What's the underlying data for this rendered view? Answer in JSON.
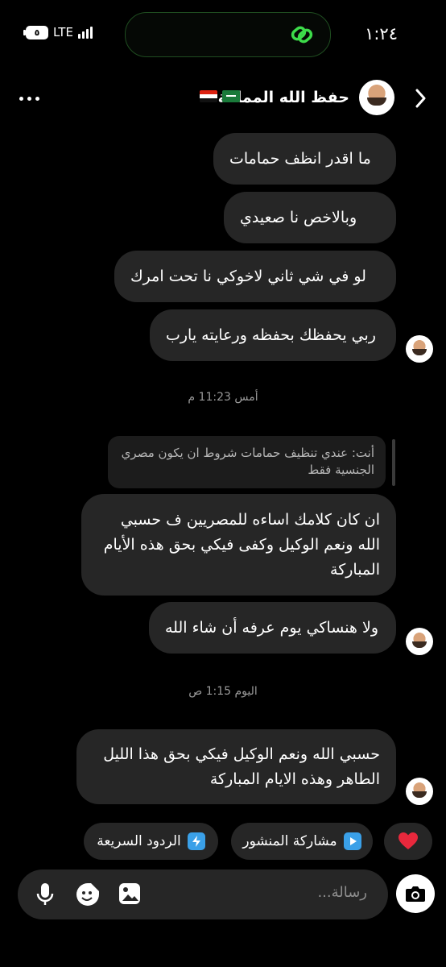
{
  "status_bar": {
    "time": "١:٢٤",
    "network": "LTE",
    "battery": "٥"
  },
  "header": {
    "name": "حفظ الله المملكة",
    "flags": [
      "saudi-flag",
      "egypt-flag"
    ]
  },
  "messages_group1": [
    "ما اقدر انظف حمامات",
    "وبالاخص نا صعيدي",
    "لو في شي ثاني لاخوكي نا تحت امرك",
    "ربي يحفظك بحفظه ورعايته يارب"
  ],
  "timestamp1": "أمس 11:23 م",
  "reply": {
    "text": "أنت: عندي تنظيف حمامات شروط ان يكون مصري الجنسية فقط"
  },
  "messages_group2": [
    "ان كان كلامك اساءه للمصريين ف حسبي الله ونعم الوكيل وكفى فيكي بحق هذه الأيام المباركة",
    "ولا هنساكي يوم عرفه أن شاء الله"
  ],
  "timestamp2": "اليوم 1:15 ص",
  "messages_group3": [
    "حسبي الله ونعم الوكيل فيكي بحق هذا الليل الطاهر وهذه الايام المباركة"
  ],
  "quick_actions": {
    "quick_replies": "الردود السريعة",
    "share_post": "مشاركة المنشور",
    "heart": "❤️"
  },
  "composer": {
    "placeholder": "رسالة..."
  }
}
